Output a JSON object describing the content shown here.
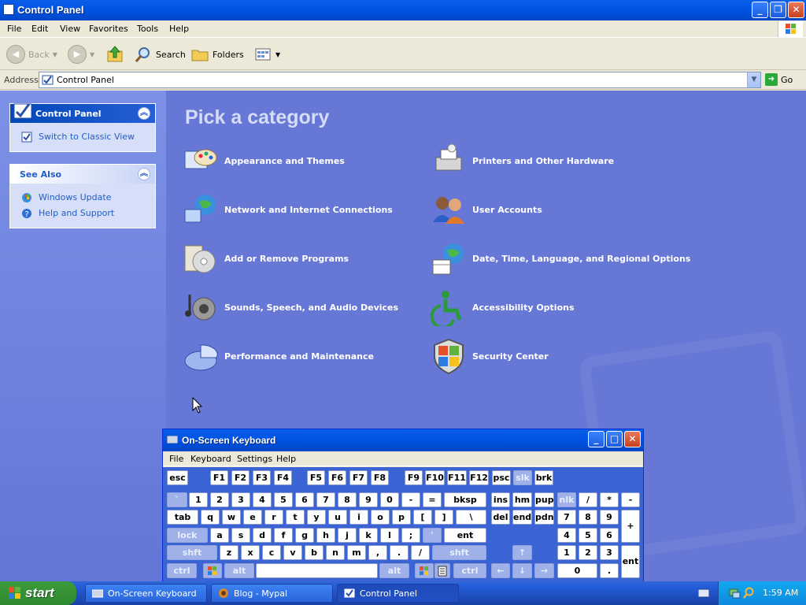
{
  "window": {
    "title": "Control Panel"
  },
  "menu": [
    "File",
    "Edit",
    "View",
    "Favorites",
    "Tools",
    "Help"
  ],
  "toolbar": {
    "back": "Back",
    "search": "Search",
    "folders": "Folders"
  },
  "address": {
    "label": "Address",
    "value": "Control Panel",
    "go": "Go"
  },
  "sidebar": {
    "panel1": {
      "title": "Control Panel",
      "link": "Switch to Classic View"
    },
    "panel2": {
      "title": "See Also",
      "links": [
        "Windows Update",
        "Help and Support"
      ]
    }
  },
  "main": {
    "heading": "Pick a category",
    "categories_left": [
      "Appearance and Themes",
      "Network and Internet Connections",
      "Add or Remove Programs",
      "Sounds, Speech, and Audio Devices",
      "Performance and Maintenance"
    ],
    "categories_right": [
      "Printers and Other Hardware",
      "User Accounts",
      "Date, Time, Language, and Regional Options",
      "Accessibility Options",
      "Security Center"
    ]
  },
  "osk": {
    "title": "On-Screen Keyboard",
    "menu": [
      "File",
      "Keyboard",
      "Settings",
      "Help"
    ],
    "keys": {
      "row0": [
        "esc",
        "F1",
        "F2",
        "F3",
        "F4",
        "F5",
        "F6",
        "F7",
        "F8",
        "F9",
        "F10",
        "F11",
        "F12",
        "psc",
        "slk",
        "brk"
      ],
      "row1": [
        "`",
        "1",
        "2",
        "3",
        "4",
        "5",
        "6",
        "7",
        "8",
        "9",
        "0",
        "-",
        "=",
        "bksp",
        "ins",
        "hm",
        "pup",
        "nlk",
        "/",
        "*",
        "-"
      ],
      "row2": [
        "tab",
        "q",
        "w",
        "e",
        "r",
        "t",
        "y",
        "u",
        "i",
        "o",
        "p",
        "[",
        "]",
        "\\",
        "del",
        "end",
        "pdn",
        "7",
        "8",
        "9",
        "+"
      ],
      "row3": [
        "lock",
        "a",
        "s",
        "d",
        "f",
        "g",
        "h",
        "j",
        "k",
        "l",
        ";",
        "'",
        "ent",
        "4",
        "5",
        "6"
      ],
      "row4": [
        "shft",
        "z",
        "x",
        "c",
        "v",
        "b",
        "n",
        "m",
        ",",
        ".",
        "/",
        "shft",
        "↑",
        "1",
        "2",
        "3",
        "ent"
      ],
      "row5": [
        "ctrl",
        "alt",
        "alt",
        "ctrl",
        "←",
        "↓",
        "→",
        "0",
        "."
      ]
    }
  },
  "taskbar": {
    "start": "start",
    "tasks": [
      "On-Screen Keyboard",
      "Blog - Mypal",
      "Control Panel"
    ],
    "clock": "1:59 AM"
  },
  "colors": {
    "titlebar": "#0055e5",
    "main_bg": "#6677d6",
    "sidebar_link": "#215dc6",
    "start_green": "#2e8a2e"
  }
}
